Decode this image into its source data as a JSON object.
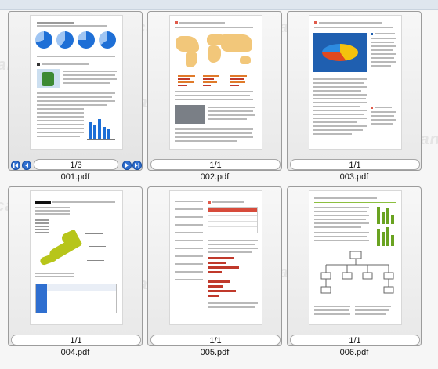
{
  "colors": {
    "accent": "#2f6fd0",
    "selection_border": "#9c9c9c"
  },
  "items": [
    {
      "filename": "001.pdf",
      "page_counter": "1/3",
      "has_nav": true
    },
    {
      "filename": "002.pdf",
      "page_counter": "1/1",
      "has_nav": false
    },
    {
      "filename": "003.pdf",
      "page_counter": "1/1",
      "has_nav": false
    },
    {
      "filename": "004.pdf",
      "page_counter": "1/1",
      "has_nav": false
    },
    {
      "filename": "005.pdf",
      "page_counter": "1/1",
      "has_nav": false
    },
    {
      "filename": "006.pdf",
      "page_counter": "1/1",
      "has_nav": false
    }
  ],
  "watermark": "ScanSnap",
  "icons": [
    "first-page-icon",
    "previous-page-icon",
    "next-page-icon",
    "last-page-icon"
  ]
}
